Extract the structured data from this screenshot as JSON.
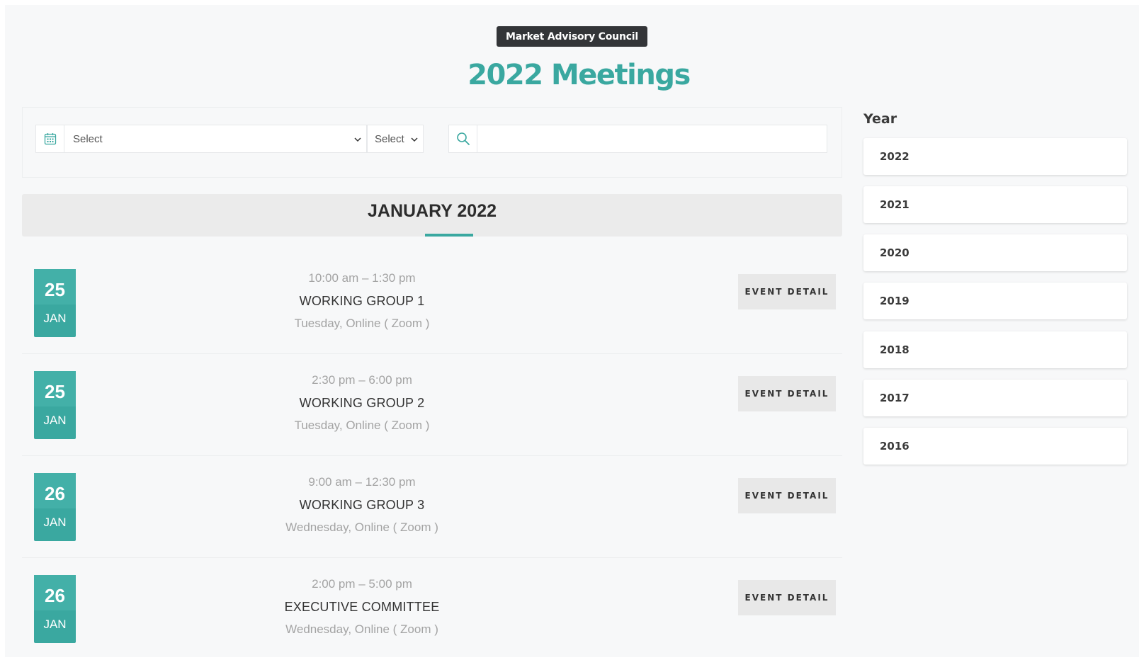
{
  "header": {
    "badge": "Market Advisory Council",
    "title": "2022 Meetings"
  },
  "filters": {
    "date_icon": "calendar-icon",
    "select_main": "Select",
    "select_small": "Select",
    "search_icon": "search-icon",
    "search_value": "",
    "search_placeholder": ""
  },
  "month": {
    "label": "JANUARY 2022"
  },
  "events": [
    {
      "day": "25",
      "month": "JAN",
      "time": "10:00 am – 1:30 pm",
      "title": "WORKING GROUP 1",
      "location": "Tuesday, Online ( Zoom )",
      "button": "EVENT DETAIL"
    },
    {
      "day": "25",
      "month": "JAN",
      "time": "2:30 pm – 6:00 pm",
      "title": "WORKING GROUP 2",
      "location": "Tuesday, Online ( Zoom )",
      "button": "EVENT DETAIL"
    },
    {
      "day": "26",
      "month": "JAN",
      "time": "9:00 am – 12:30 pm",
      "title": "WORKING GROUP 3",
      "location": "Wednesday, Online ( Zoom )",
      "button": "EVENT DETAIL"
    },
    {
      "day": "26",
      "month": "JAN",
      "time": "2:00 pm – 5:00 pm",
      "title": "EXECUTIVE COMMITTEE",
      "location": "Wednesday, Online ( Zoom )",
      "button": "EVENT DETAIL"
    }
  ],
  "sidebar": {
    "heading": "Year",
    "years": [
      "2022",
      "2021",
      "2020",
      "2019",
      "2018",
      "2017",
      "2016"
    ]
  },
  "colors": {
    "accent": "#3aa8a0",
    "badge_bg": "#333538",
    "button_bg": "#e8e8e8"
  }
}
